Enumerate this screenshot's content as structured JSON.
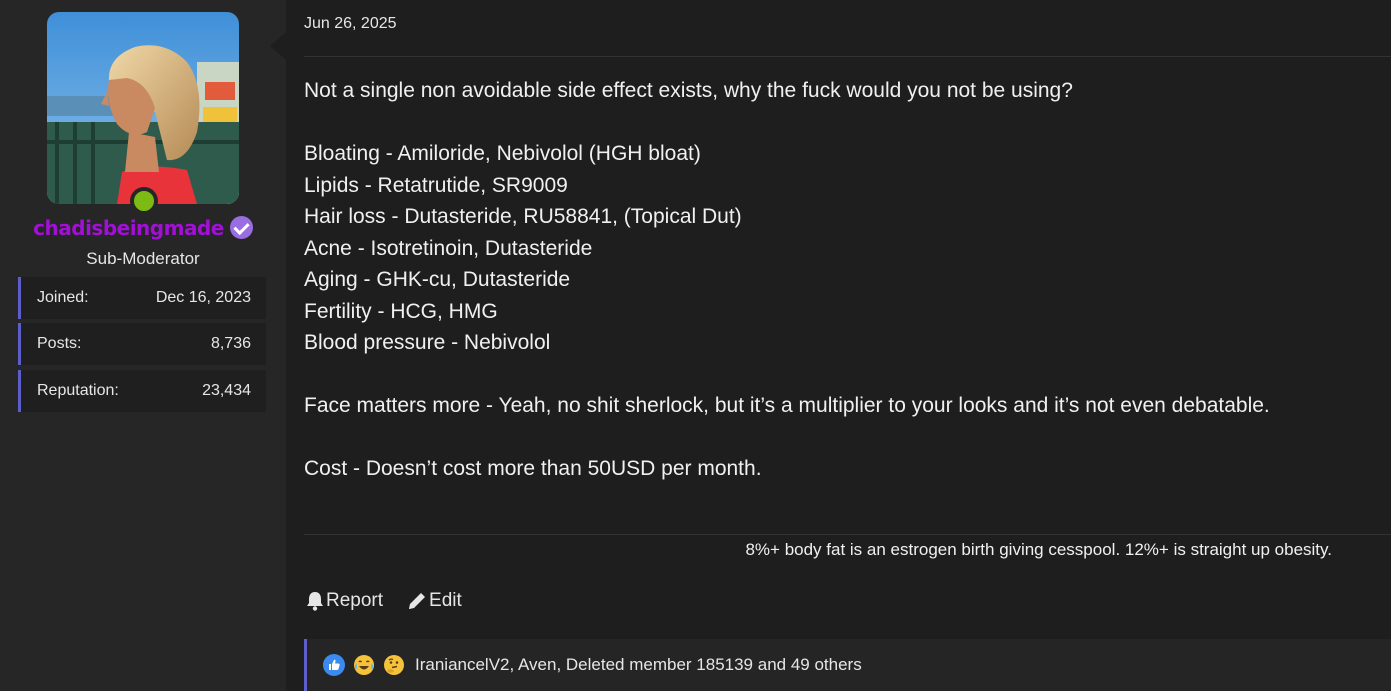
{
  "author": {
    "username": "chadisbeingmade",
    "role": "Sub-Moderator",
    "stats": [
      {
        "label": "Joined:",
        "value": "Dec 16, 2023"
      },
      {
        "label": "Posts:",
        "value": "8,736"
      },
      {
        "label": "Reputation:",
        "value": "23,434"
      }
    ],
    "online": true,
    "verified_icon": "check-badge-icon"
  },
  "post": {
    "date": "Jun 26, 2025",
    "lines": [
      "Not a single non avoidable side effect exists, why the fuck would you not be using?",
      "",
      "Bloating - Amiloride, Nebivolol (HGH bloat)",
      "Lipids - Retatrutide, SR9009",
      "Hair loss - Dutasteride, RU58841, (Topical Dut)",
      "Acne - Isotretinoin, Dutasteride",
      "Aging - GHK-cu, Dutasteride",
      "Fertility - HCG, HMG",
      "Blood pressure - Nebivolol",
      "",
      "Face matters more - Yeah, no shit sherlock, but it’s a multiplier to your looks and it’s not even debatable.",
      "",
      "Cost - Doesn’t cost more than 50USD per month."
    ],
    "signature": "8%+ body fat is an estrogen birth giving cesspool. 12%+ is straight up obesity."
  },
  "actions": {
    "report_label": "Report",
    "edit_label": "Edit"
  },
  "reactions": {
    "icons": [
      "thumbs-up-icon",
      "laughing-crying-icon",
      "thinking-icon"
    ],
    "text": "IraniancelV2, Aven, Deleted member 185139 and 49 others"
  },
  "colors": {
    "username": "#a20fd6",
    "accent": "#5c5fc9",
    "online": "#7cbb14",
    "verified": "#9b6de3"
  }
}
